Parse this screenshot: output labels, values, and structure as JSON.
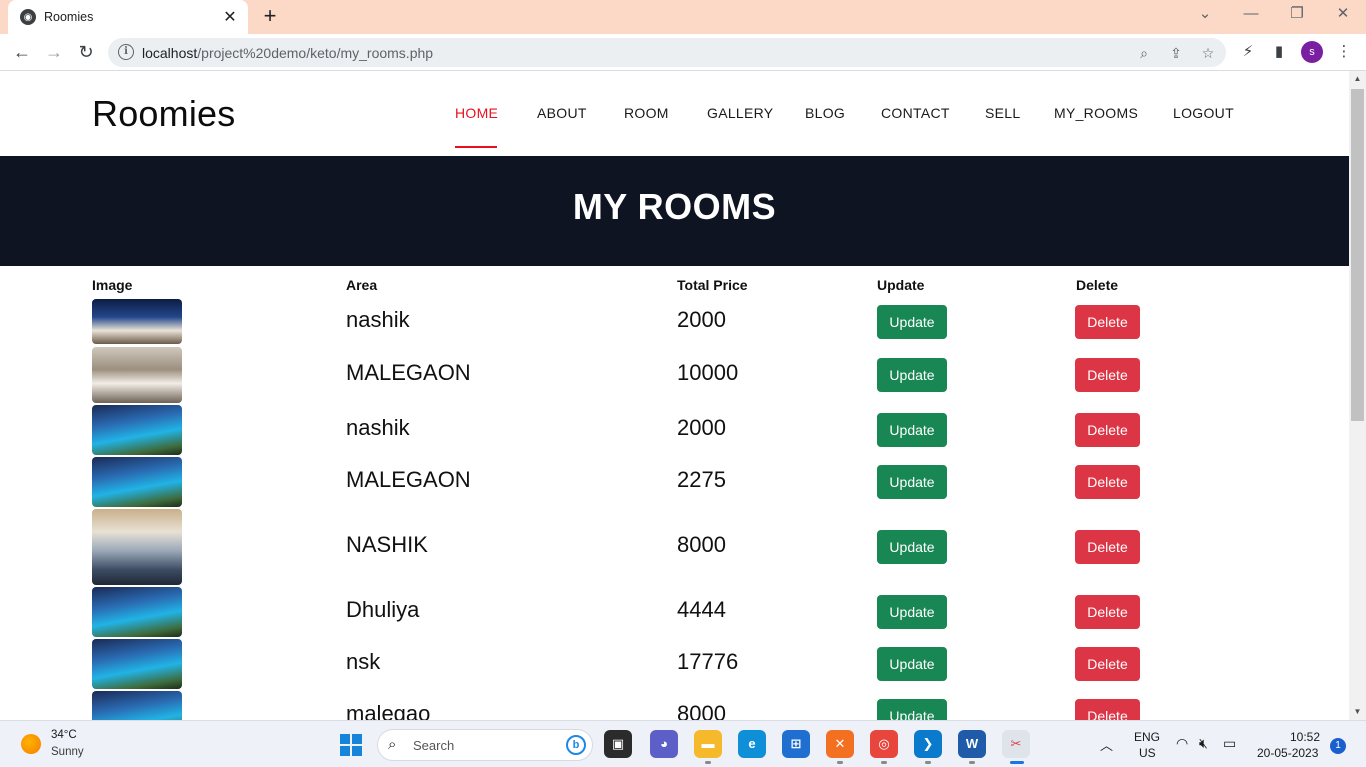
{
  "browser": {
    "tab_title": "Roomies",
    "tab_close": "✕",
    "new_tab": "+",
    "url_host": "localhost",
    "url_path": "/project%20demo/keto/my_rooms.php",
    "profile_initial": "s",
    "accent": "#fbd9c6"
  },
  "site": {
    "brand": "Roomies",
    "nav": [
      "HOME",
      "ABOUT",
      "ROOM",
      "GALLERY",
      "BLOG",
      "CONTACT",
      "SELL",
      "MY_ROOMS",
      "LOGOUT"
    ],
    "active_nav": "HOME",
    "active_color": "#e8101e",
    "hero_title": "MY ROOMS",
    "hero_bg": "#0e1421"
  },
  "table": {
    "headers": [
      "Image",
      "Area",
      "Total Price",
      "Update",
      "Delete"
    ],
    "update_label": "Update",
    "delete_label": "Delete",
    "rows": [
      {
        "area": "nashik",
        "price": "2000",
        "image": "room-interior-night"
      },
      {
        "area": "MALEGAON",
        "price": "10000",
        "image": "bedroom-suite"
      },
      {
        "area": "nashik",
        "price": "2000",
        "image": "resort-pool"
      },
      {
        "area": "MALEGAON",
        "price": "2275",
        "image": "resort-pool"
      },
      {
        "area": "NASHIK",
        "price": "8000",
        "image": "living-room-view"
      },
      {
        "area": "Dhuliya",
        "price": "4444",
        "image": "resort-pool"
      },
      {
        "area": "nsk",
        "price": "17776",
        "image": "resort-pool"
      },
      {
        "area": "malegao",
        "price": "8000",
        "image": "resort-pool"
      }
    ]
  },
  "taskbar": {
    "weather_temp": "34°C",
    "weather_desc": "Sunny",
    "search_label": "Search",
    "lang_1": "ENG",
    "lang_2": "US",
    "time": "10:52",
    "date": "20-05-2023",
    "notifications": "1"
  }
}
